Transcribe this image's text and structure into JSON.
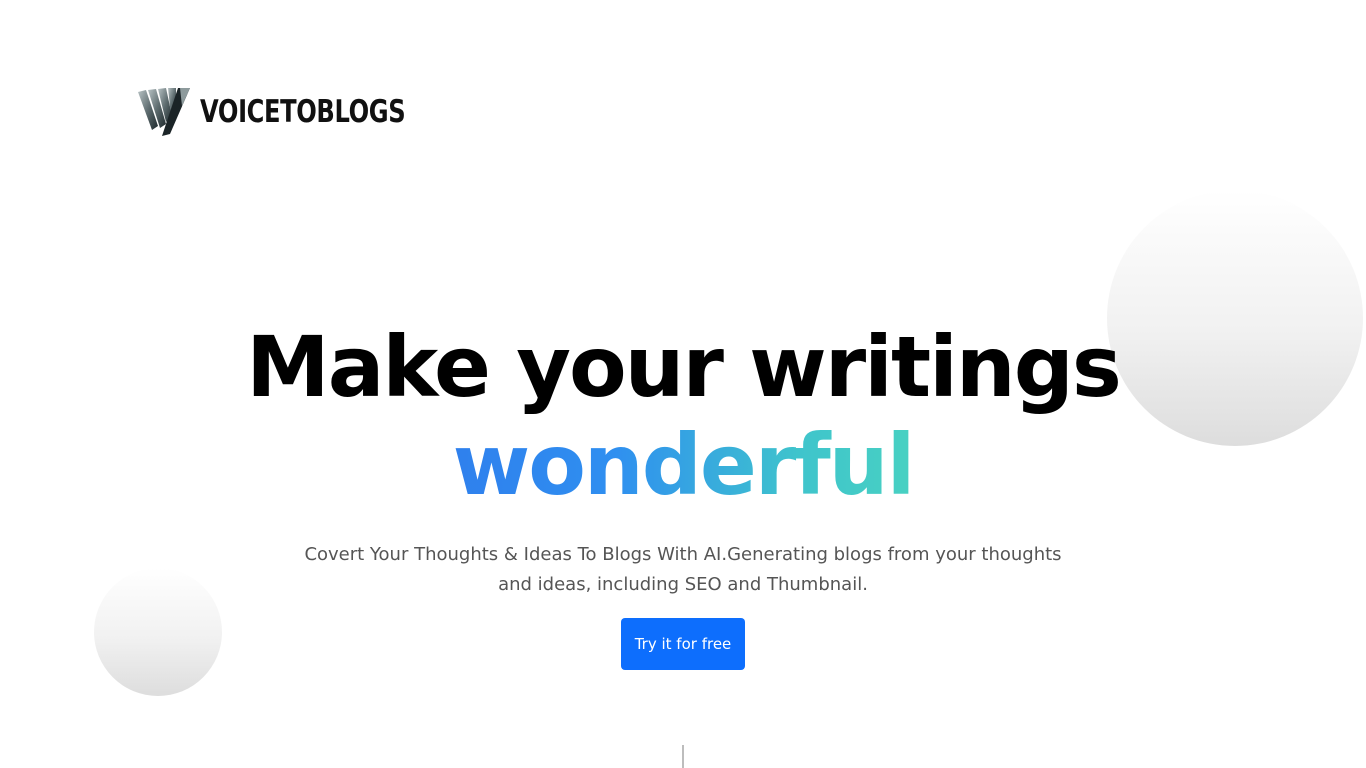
{
  "header": {
    "logo_icon": "wave-logo-icon",
    "brand_name": "VOICETOBLOGS"
  },
  "hero": {
    "headline_line1": "Make your writings",
    "headline_accent": "wonderful",
    "subtitle": "Covert Your Thoughts & Ideas To Blogs With AI.Generating blogs from your thoughts and ideas, including SEO and Thumbnail.",
    "cta_label": "Try it for free"
  },
  "colors": {
    "primary_button": "#0d6efd",
    "accent_gradient_start": "#2f80ed",
    "accent_gradient_end": "#48d1c2",
    "headline": "#000000",
    "subtitle": "#555555"
  }
}
